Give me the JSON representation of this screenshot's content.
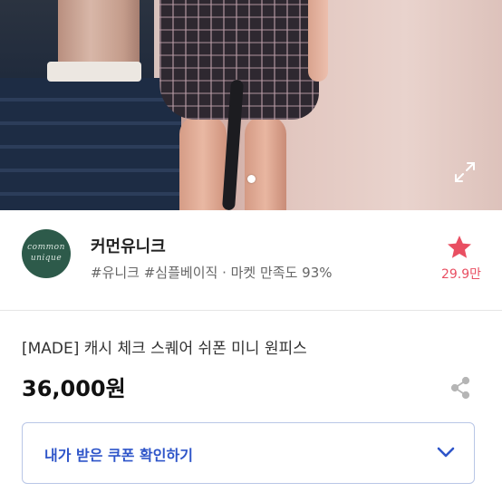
{
  "seller": {
    "avatar_line1": "common",
    "avatar_line2": "unique",
    "name": "커먼유니크",
    "tags": "#유니크 #심플베이직 · 마켓 만족도 93%",
    "like_count": "29.9만"
  },
  "product": {
    "title": "[MADE] 캐시 체크 스퀘어 쉬폰 미니 원피스",
    "price": "36,000원"
  },
  "coupon": {
    "label": "내가 받은 쿠폰 확인하기"
  },
  "colors": {
    "accent_star": "#e94f62",
    "coupon_text": "#2e55c9",
    "avatar_bg": "#2d5a4a"
  },
  "icons": {
    "expand": "expand-icon",
    "star": "star-icon",
    "share": "share-icon",
    "chevron": "chevron-down-icon"
  }
}
